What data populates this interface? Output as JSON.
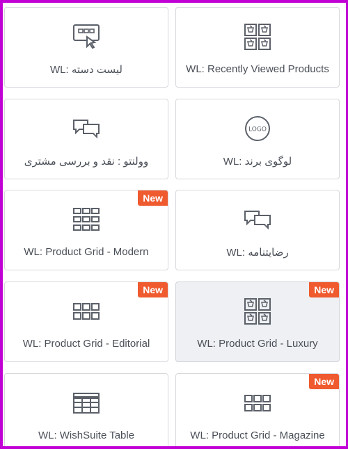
{
  "widgets": [
    {
      "label": "WL: لیست دسته",
      "icon": "category-list-icon",
      "badge": ""
    },
    {
      "label": "WL: Recently Viewed Products",
      "icon": "recently-viewed-products-icon",
      "badge": ""
    },
    {
      "label": "وولنتو : نقد و بررسی مشتری",
      "icon": "chat-bubbles-icon",
      "badge": ""
    },
    {
      "label": "WL: لوگوی برند",
      "icon": "brand-logo-icon",
      "badge": ""
    },
    {
      "label": "WL: Product Grid - Modern",
      "icon": "grid-six-icon",
      "badge": "New"
    },
    {
      "label": "WL: رضایتنامه",
      "icon": "chat-bubbles-icon",
      "badge": ""
    },
    {
      "label": "WL: Product Grid - Editorial",
      "icon": "grid-six-icon",
      "badge": "New"
    },
    {
      "label": "WL: Product Grid - Luxury",
      "icon": "product-grid-basket-icon",
      "badge": "New"
    },
    {
      "label": "WL: WishSuite Table",
      "icon": "table-icon",
      "badge": ""
    },
    {
      "label": "WL: Product Grid - Magazine",
      "icon": "grid-six-icon",
      "badge": "New"
    }
  ],
  "colors": {
    "frame": "#c100d6",
    "badge": "#ef5a2e",
    "icon": "#5b6069",
    "text": "#4a4f57",
    "selected_bg": "#eef0f3"
  }
}
